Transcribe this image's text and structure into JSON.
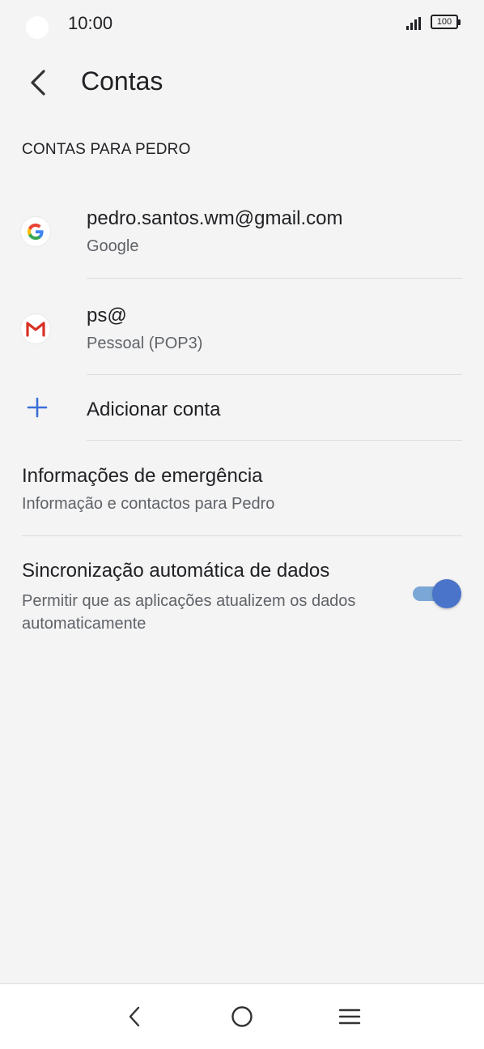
{
  "status_bar": {
    "time": "10:00",
    "battery": "100"
  },
  "header": {
    "title": "Contas",
    "back_icon": "chevron-left-icon"
  },
  "section": {
    "title": "CONTAS PARA PEDRO"
  },
  "accounts": [
    {
      "title": "pedro.santos.wm@gmail.com",
      "subtitle": "Google",
      "icon": "google-icon"
    },
    {
      "title": "ps@",
      "subtitle": "Pessoal (POP3)",
      "icon": "gmail-icon"
    }
  ],
  "add_account": {
    "label": "Adicionar conta",
    "icon": "plus-icon",
    "accent": "#3b6fd8"
  },
  "emergency": {
    "title": "Informações de emergência",
    "subtitle": "Informação e contactos para Pedro"
  },
  "auto_sync": {
    "title": "Sincronização automática de dados",
    "subtitle": "Permitir que as aplicações atualizem os dados automaticamente",
    "enabled": true,
    "accent": "#4a74c9"
  },
  "nav_bar": {
    "buttons": [
      "back-icon",
      "home-icon",
      "recents-icon"
    ]
  }
}
